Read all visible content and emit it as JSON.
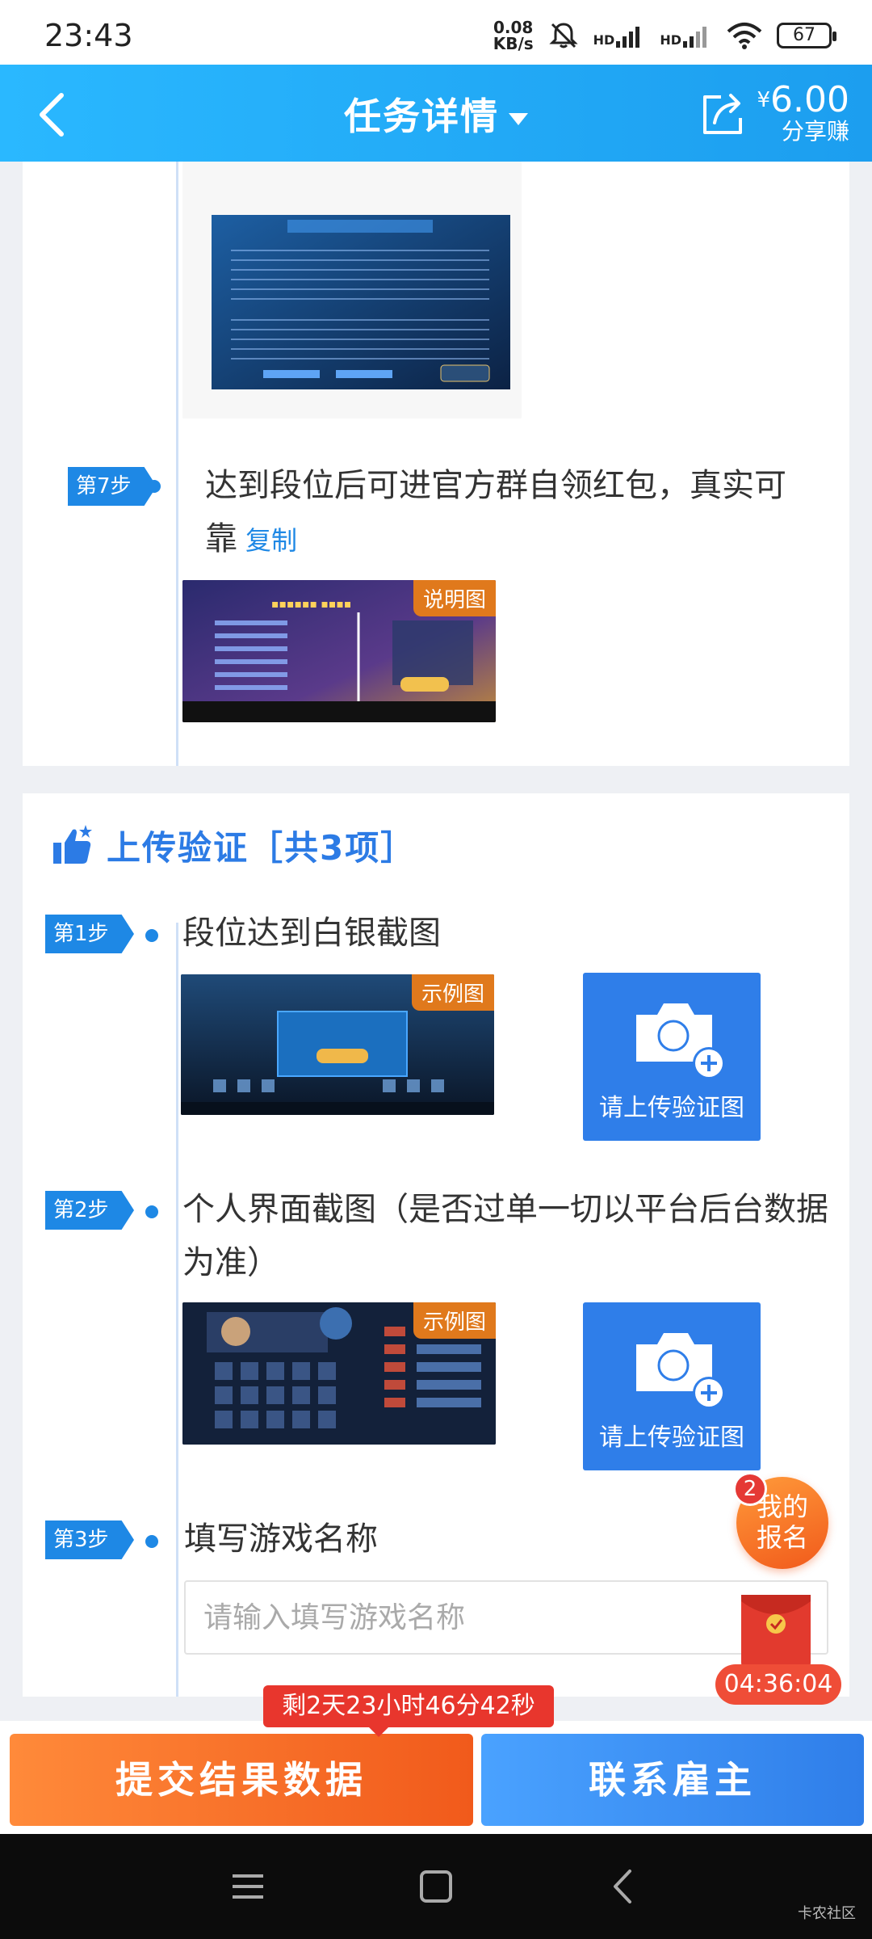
{
  "status_bar": {
    "time": "23:43",
    "net_speed_value": "0.08",
    "net_speed_unit": "KB/s",
    "signal1": "HD",
    "signal2": "HD",
    "battery": "67"
  },
  "header": {
    "title": "任务详情",
    "share_currency": "¥",
    "share_amount": "6.00",
    "share_label": "分享赚"
  },
  "top_card": {
    "step7": {
      "badge": "第7步",
      "text": "达到段位后可进官方群自领红包，真实可靠",
      "copy": "复制",
      "image_tag": "说明图"
    }
  },
  "upload_section": {
    "title": "上传验证［共3项］",
    "steps": [
      {
        "badge": "第1步",
        "text": "段位达到白银截图",
        "tag": "示例图",
        "upload_label": "请上传验证图"
      },
      {
        "badge": "第2步",
        "text": "个人界面截图（是否过单一切以平台后台数据为准）",
        "tag": "示例图",
        "upload_label": "请上传验证图"
      },
      {
        "badge": "第3步",
        "text": "填写游戏名称",
        "placeholder": "请输入填写游戏名称"
      }
    ]
  },
  "floating": {
    "my_signup": "我的报名",
    "signup_count": "2",
    "timer": "04:36:04"
  },
  "bottom": {
    "countdown": "剩2天23小时46分42秒",
    "submit": "提交结果数据",
    "contact": "联系雇主"
  },
  "watermark": "卡农社区",
  "colors": {
    "header": "#1c9eef",
    "step_badge": "#1e88e5",
    "submit": "#f15a1b",
    "contact": "#2f7ee9",
    "countdown": "#e8362d"
  }
}
